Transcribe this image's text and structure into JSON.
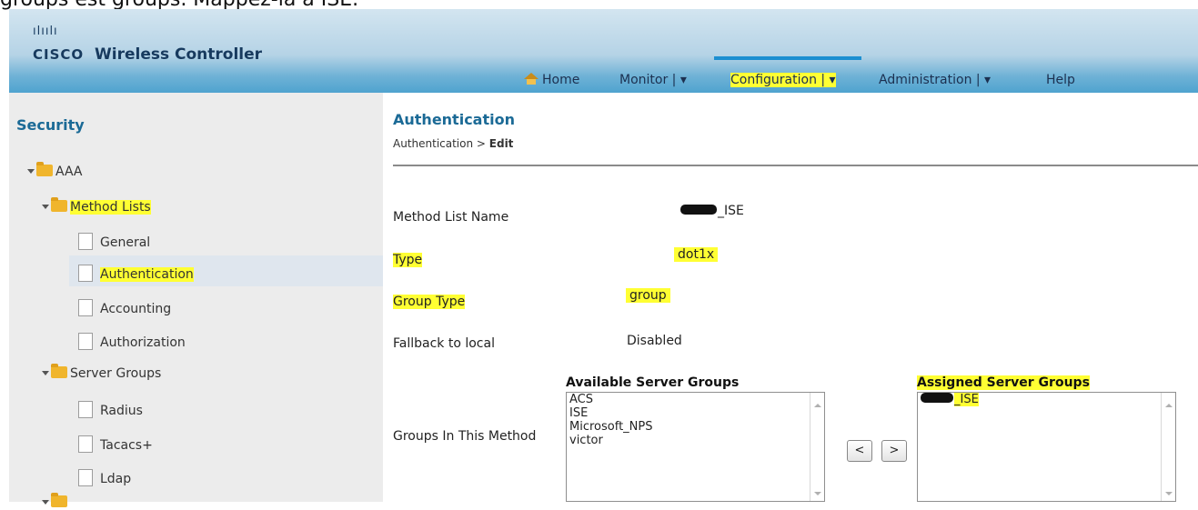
{
  "caption": "groups est groups. Mappez-la à ISE.",
  "header": {
    "logo_mark": "ılıılı",
    "logo_word": "CISCO",
    "product": "Wireless Controller",
    "nav": {
      "home": "Home",
      "monitor": "Monitor | ▾",
      "configuration": "Configuration | ▾",
      "administration": "Administration | ▾",
      "help": "Help"
    }
  },
  "sidebar": {
    "title": "Security",
    "aaa": "AAA",
    "method_lists": "Method Lists",
    "general": "General",
    "authentication": "Authentication",
    "accounting": "Accounting",
    "authorization": "Authorization",
    "server_groups": "Server Groups",
    "radius": "Radius",
    "tacacs": "Tacacs+",
    "ldap": "Ldap"
  },
  "main": {
    "title": "Authentication",
    "breadcrumb_parent": "Authentication > ",
    "breadcrumb_current": "Edit",
    "fields": {
      "method_list_name_label": "Method List Name",
      "method_list_name_value": "_ISE",
      "type_label": "Type",
      "type_value": "dot1x",
      "group_type_label": "Group Type",
      "group_type_value": "group",
      "fallback_label": "Fallback to local",
      "fallback_value": "Disabled",
      "groups_label": "Groups In This Method"
    },
    "available_header": "Available Server Groups",
    "available": [
      "ACS",
      "ISE",
      "Microsoft_NPS",
      "victor"
    ],
    "assigned_header": "Assigned Server Groups",
    "assigned": [
      "_ISE"
    ],
    "move_left": "<",
    "move_right": ">"
  },
  "colors": {
    "highlight": "#ffff33",
    "accent": "#1b6a96",
    "active_tab": "#1c8fd1"
  }
}
